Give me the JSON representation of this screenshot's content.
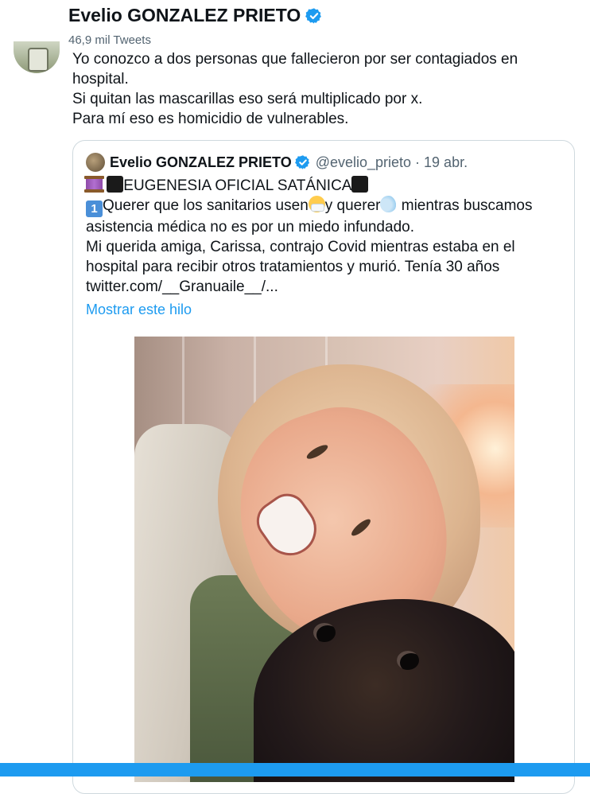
{
  "header": {
    "profile_name": "Evelio GONZALEZ PRIETO",
    "tweet_count": "46,9 mil Tweets"
  },
  "tweet": {
    "lines": [
      "Yo conozco a dos personas que fallecieron por ser contagiados en",
      "hospital.",
      "Si quitan las mascarillas eso será multiplicado por x.",
      "Para mí eso es homicidio de vulnerables."
    ]
  },
  "quote": {
    "name": "Evelio GONZALEZ PRIETO",
    "handle_date": "@evelio_prieto · 19 abr.",
    "line1_text": "EUGENESIA OFICIAL SATÁNICA",
    "line2_a": "Querer que los sanitarios usen",
    "line2_b": "y querer",
    "line2_c": " mientras buscamos",
    "line3": "asistencia médica no es por un miedo infundado.",
    "line4": "Mi querida amiga, Carissa, contrajo Covid mientras estaba en el",
    "line5": "hospital para recibir otros tratamientos y murió. Tenía 30 años",
    "line6": "twitter.com/__Granuaile__/...",
    "show_thread": "Mostrar este hilo",
    "emoji_one": "1"
  },
  "icons": {
    "verified": "verified-badge-icon",
    "spool": "thread-spool-emoji",
    "black_square": "black-square-emoji",
    "keycap_one": "keycap-one-emoji",
    "mask": "face-with-mask-emoji",
    "wind": "wind-face-emoji"
  },
  "colors": {
    "accent": "#1d9bf0",
    "text": "#0f1419",
    "secondary": "#536471",
    "border": "#cfd9de"
  }
}
